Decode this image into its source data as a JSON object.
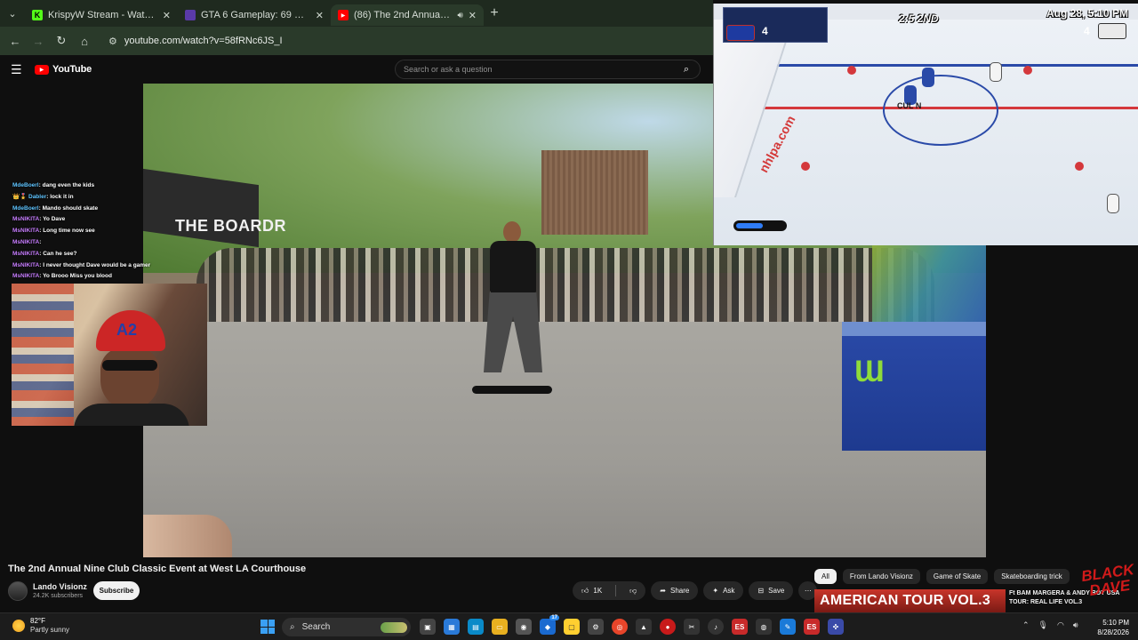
{
  "browser": {
    "tabs": [
      {
        "label": "KrispyW Stream - Watch Live on Kick",
        "favicon": "K",
        "favicon_color": "#53fc18",
        "active": false
      },
      {
        "label": "GTA 6 Gameplay: 69 New Details",
        "favicon": "",
        "favicon_color": "#5a3aa8",
        "active": false
      },
      {
        "label": "(86) The 2nd Annual Nine Club Classic",
        "favicon": "▶",
        "favicon_color": "#ff0000",
        "active": true
      }
    ],
    "url": "youtube.com/watch?v=58fRNc6JS_I"
  },
  "youtube": {
    "logo_text": "YouTube",
    "search_placeholder": "Search or ask a question"
  },
  "video": {
    "tent_text": "THE BOARDR"
  },
  "game": {
    "score_left": "4",
    "score_right": "4",
    "period": "2:5 2ND",
    "date_overlay": "Aug 28, 5:10 PM",
    "meter_fill": 0.55,
    "ad_left": "nhlpa.com",
    "center_text": "CUL N"
  },
  "chat": [
    {
      "user": "MdeBoerl",
      "user_color": "#5ec4ff",
      "text": "dang even the kids"
    },
    {
      "user": "Dabler",
      "user_color": "#5ec4ff",
      "text": "lock it in",
      "badges": "👑🎖️"
    },
    {
      "user": "MdeBoerl",
      "user_color": "#5ec4ff",
      "text": "Mando should skate"
    },
    {
      "user": "MsNIKITA",
      "user_color": "#c77dff",
      "text": "Yo Dave"
    },
    {
      "user": "MsNIKITA",
      "user_color": "#c77dff",
      "text": "Long time now see"
    },
    {
      "user": "MsNIKITA",
      "user_color": "#c77dff",
      "text": ""
    },
    {
      "user": "MsNIKITA",
      "user_color": "#c77dff",
      "text": "Can he see?"
    },
    {
      "user": "MsNIKITA",
      "user_color": "#c77dff",
      "text": "I never thought Dave would be a gamer"
    },
    {
      "user": "MsNIKITA",
      "user_color": "#c77dff",
      "text": "Yo Brooo Miss you blood"
    }
  ],
  "webcam": {
    "cap_text": "A2"
  },
  "info": {
    "title": "The 2nd Annual Nine Club Classic Event at West LA Courthouse",
    "channel": "Lando Visionz",
    "subscribers": "24.2K subscribers",
    "subscribe_label": "Subscribe",
    "likes": "1K",
    "share_label": "Share",
    "ask_label": "Ask",
    "save_label": "Save"
  },
  "recommendations": {
    "chips": [
      "All",
      "From Lando Visionz",
      "Game of Skate",
      "Skateboarding trick"
    ],
    "active_chip": "All",
    "thumb_text": "AMERICAN TOUR VOL.3",
    "title": "Ft BAM MARGERA & ANDY ROY USA TOUR: REAL LIFE VOL.3",
    "brand_mark": "BLACK DAVE"
  },
  "taskbar": {
    "temperature": "82°F",
    "condition": "Partly sunny",
    "search_label": "Search",
    "time": "5:10 PM",
    "date": "8/28/2026",
    "app_badge": "17"
  },
  "colors": {
    "accent": "#ff0000",
    "chrome_bg": "#2a3a2a",
    "ramp_blue": "#1e3a8f"
  }
}
